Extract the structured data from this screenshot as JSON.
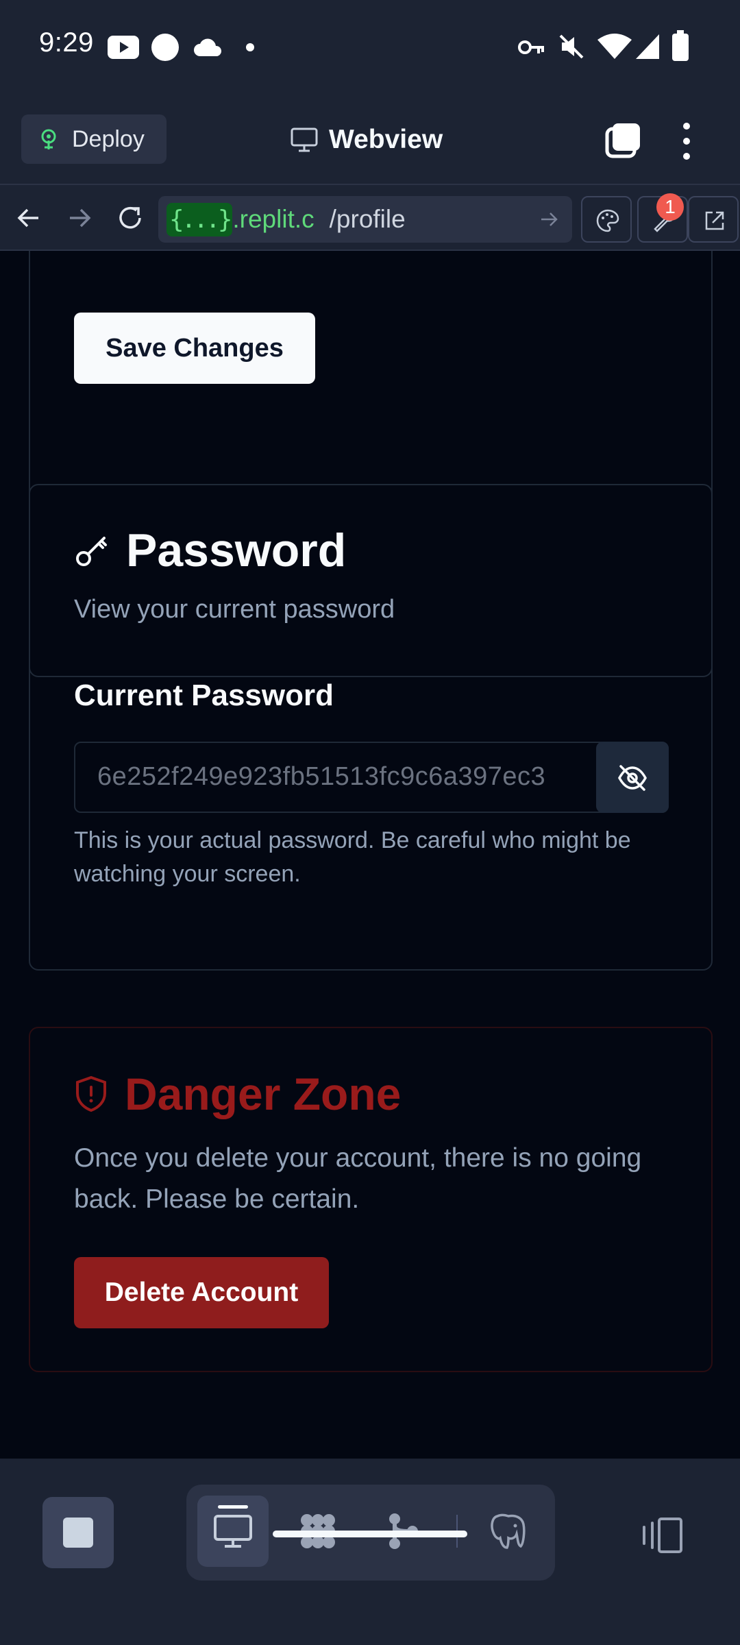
{
  "status_bar": {
    "time": "9:29",
    "icons": [
      "youtube-icon",
      "circle-icon",
      "cloud-icon",
      "dot-icon",
      "key-icon",
      "mute-icon",
      "wifi-icon",
      "signal-icon",
      "battery-icon"
    ]
  },
  "app_header": {
    "deploy_label": "Deploy",
    "title": "Webview"
  },
  "url_bar": {
    "host_prefix": "{...}",
    "host": ".replit.c",
    "path": "/profile",
    "tools_badge": "1"
  },
  "profile_card": {
    "save_label": "Save Changes"
  },
  "password_card": {
    "title": "Password",
    "subtitle": "View your current password",
    "field_label": "Current Password",
    "password_value": "6e252f249e923fb51513fc9c6a397ec3",
    "hint": "This is your actual password. Be careful who might be watching your screen."
  },
  "danger_card": {
    "title": "Danger Zone",
    "description": "Once you delete your account, there is no going back. Please be certain.",
    "delete_label": "Delete Account"
  },
  "bottom_bar": {
    "tools": [
      "webview",
      "workspace",
      "git",
      "database"
    ],
    "active_tool": "webview"
  },
  "colors": {
    "ide_bg": "#1c2333",
    "page_bg": "#030712",
    "danger_red": "#991b1b",
    "delete_button": "#8f1d1d",
    "url_host_green": "#5fd97a"
  }
}
